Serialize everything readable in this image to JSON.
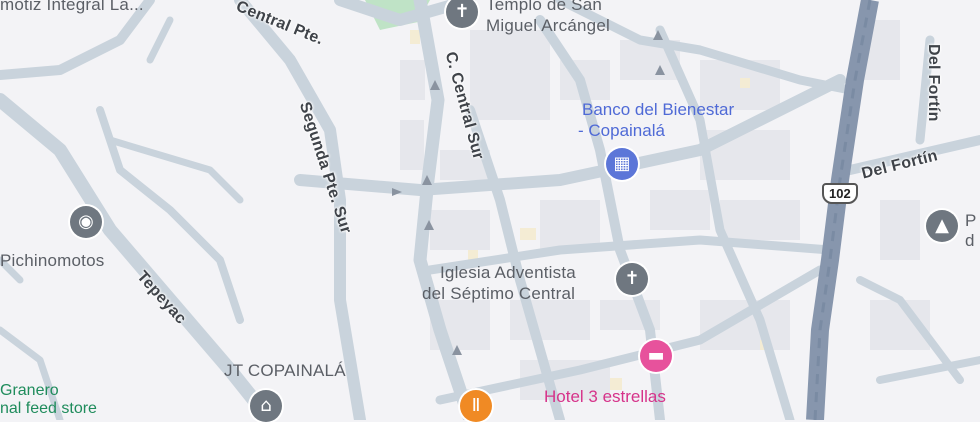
{
  "map": {
    "highway_shield": "102",
    "streets": {
      "central_pte": "Central Pte.",
      "c_central_sur": "C. Central Sur",
      "segunda_pte_sur": "Segunda Pte. Sur",
      "tepeyac": "Tepeyac",
      "del_fortin_vertical": "Del Fortín",
      "del_fortin_horizontal": "Del Fortín"
    },
    "places": {
      "clinic_top_left": "motiz Integral La...",
      "templo_line1": "Templo de San",
      "templo_line2": "Miguel Arcángel",
      "banco_line1": "Banco del Bienestar",
      "banco_line2": "- Copainalá",
      "iglesia_line1": "Iglesia Adventista",
      "iglesia_line2": "del Séptimo Central",
      "pichinomotos": "Pichinomotos",
      "jt_copainala": "JT COPAINALÁ",
      "hotel": "Hotel 3 estrellas",
      "granero_line1": "Granero",
      "granero_line2": "nal feed store",
      "right_edge_line1": "P",
      "right_edge_line2": "d"
    },
    "colors": {
      "background": "#f3f3f6",
      "road": "#c9d3dc",
      "highway": "#8796ad",
      "park": "#bfe3c6",
      "poi_blue": "#5c76d8",
      "poi_pink": "#e7529c",
      "poi_orange": "#f08a24",
      "poi_gray": "#6f7780"
    },
    "icons": {
      "church": "church-icon",
      "bank": "bank-icon",
      "hotel": "bed-icon",
      "restaurant": "fork-knife-icon",
      "location": "location-icon",
      "museum": "museum-icon",
      "monument": "monument-icon"
    }
  }
}
